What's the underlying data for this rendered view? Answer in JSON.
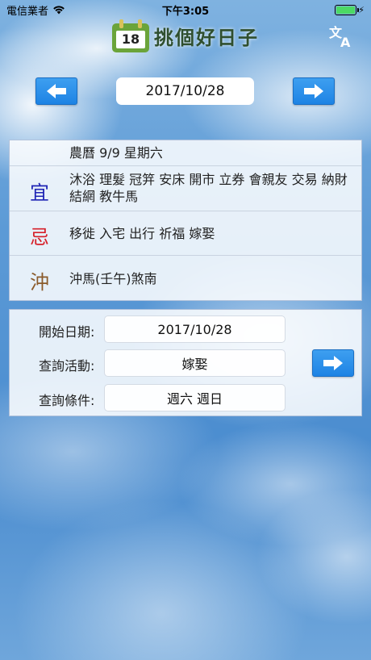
{
  "status_bar": {
    "carrier": "電信業者",
    "time": "下午3:05",
    "battery_level": 1.0,
    "icons": [
      "wifi-icon",
      "battery-icon",
      "charging-bolt-icon"
    ]
  },
  "header": {
    "logo_day": "18",
    "title": "挑個好日子",
    "icons": [
      "calendar-icon",
      "translate-icon"
    ]
  },
  "date_nav": {
    "date": "2017/10/28",
    "icons": [
      "arrow-left-icon",
      "arrow-right-icon"
    ]
  },
  "almanac": {
    "lunar": "農曆 9/9 星期六",
    "yi_char": "宜",
    "yi_items": "沐浴 理髮 冠笄 安床 開市 立券 會親友 交易 納財 結網 教牛馬",
    "ji_char": "忌",
    "ji_items": "移徙 入宅 出行 祈福 嫁娶",
    "chong_char": "沖",
    "chong_text": "沖馬(壬午)煞南"
  },
  "query": {
    "start_date_label": "開始日期:",
    "start_date_value": "2017/10/28",
    "activity_label": "查詢活動:",
    "activity_value": "嫁娶",
    "condition_label": "查詢條件:",
    "condition_value": "週六 週日"
  },
  "colors": {
    "button_blue": "#1d83e4",
    "yi": "#1f25b5",
    "ji": "#d6202a",
    "chong": "#8a5a2a",
    "battery": "#4cd964"
  }
}
